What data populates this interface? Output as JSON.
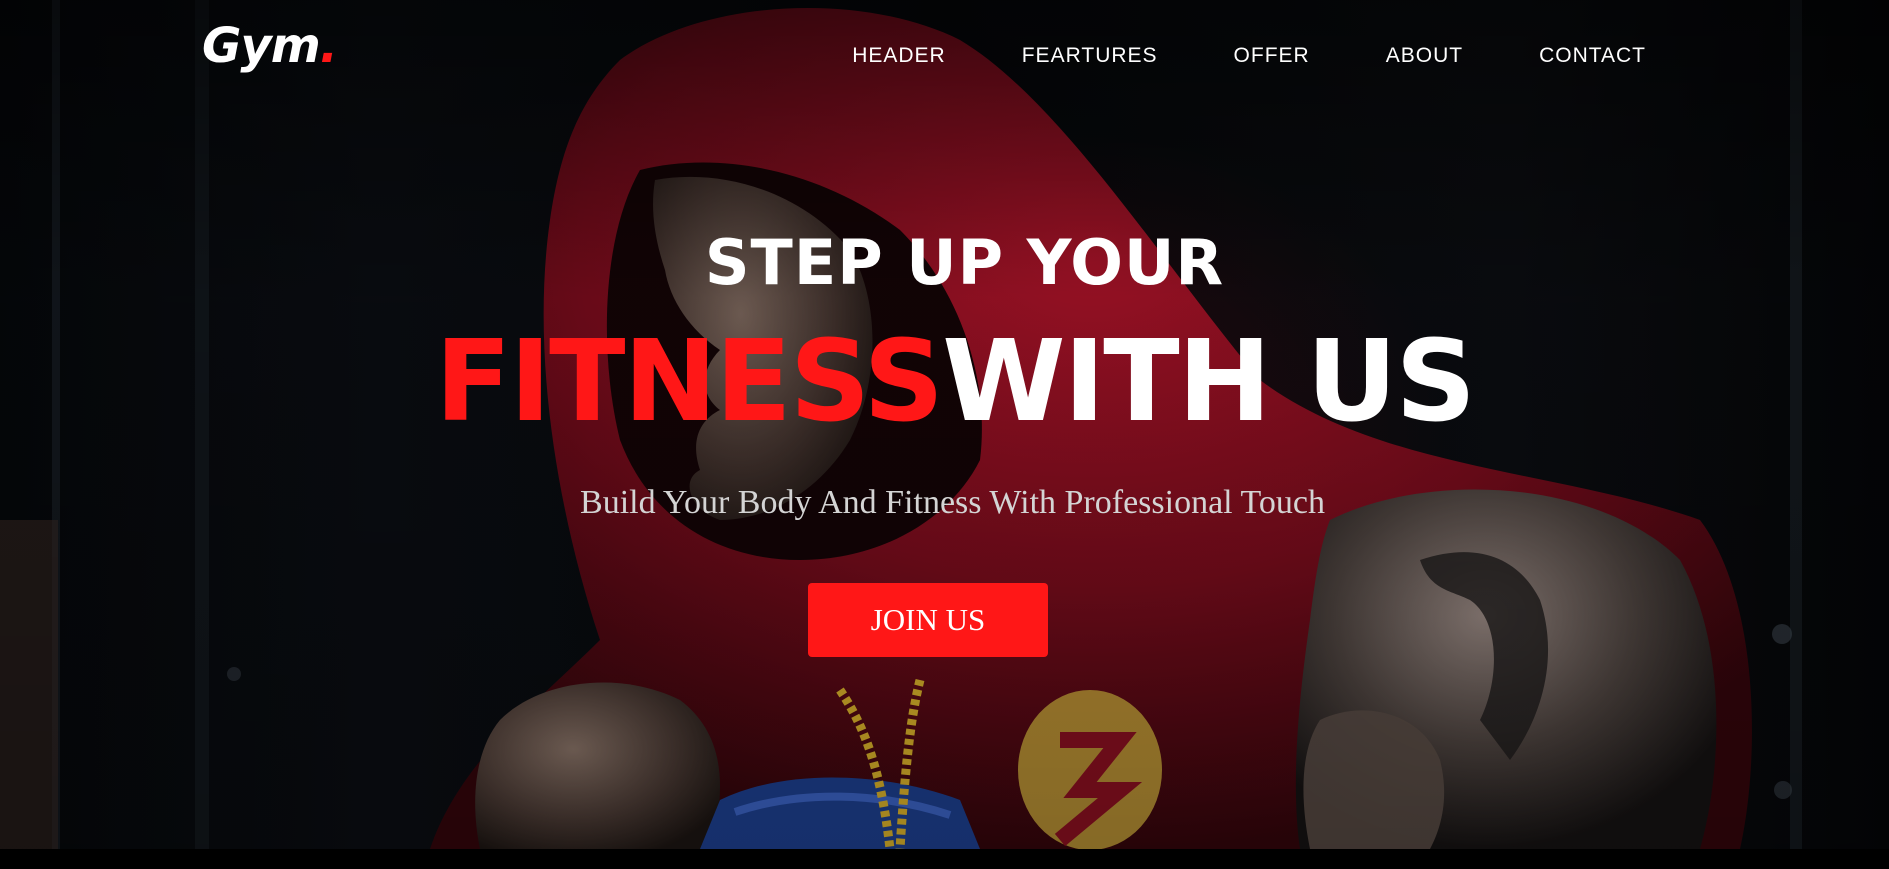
{
  "brand": {
    "logo_text": "Gym",
    "logo_dot": ".",
    "accent_color": "#ff1717"
  },
  "nav": {
    "items": [
      {
        "label": "HEADER"
      },
      {
        "label": "FEARTURES"
      },
      {
        "label": "OFFER"
      },
      {
        "label": "ABOUT"
      },
      {
        "label": "CONTACT"
      }
    ]
  },
  "hero": {
    "line1": "STEP UP YOUR",
    "line2_highlight": "FITNESS",
    "line2_rest": "WITH US",
    "subtitle": "Build Your Body And Fitness With Professional Touch",
    "cta_label": "JOIN US"
  }
}
